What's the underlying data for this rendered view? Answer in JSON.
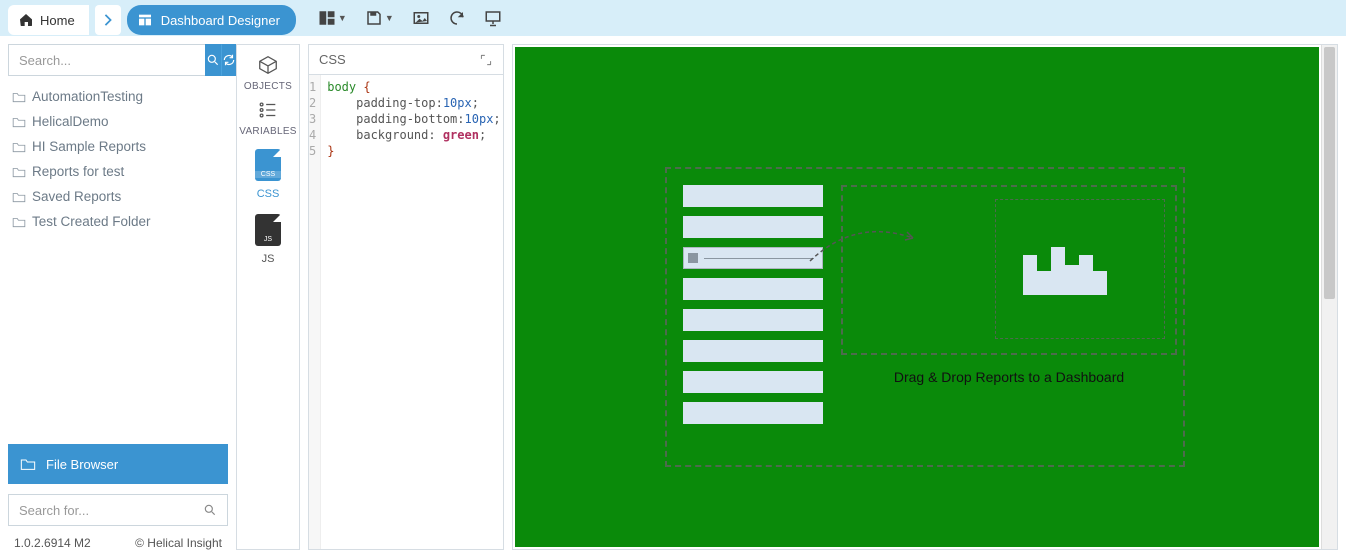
{
  "breadcrumb": {
    "home": "Home",
    "designer": "Dashboard Designer"
  },
  "search": {
    "placeholder": "Search..."
  },
  "folders": [
    "AutomationTesting",
    "HelicalDemo",
    "HI Sample Reports",
    "Reports for test",
    "Saved Reports",
    "Test Created Folder"
  ],
  "fileBrowser": {
    "label": "File Browser",
    "searchPlaceholder": "Search for..."
  },
  "footer": {
    "version": "1.0.2.6914 M2",
    "copyright": "© Helical Insight"
  },
  "tools": {
    "objects": "OBJECTS",
    "variables": "VARIABLES",
    "css": "CSS",
    "js": "JS"
  },
  "editor": {
    "title": "CSS",
    "lines": [
      "1",
      "2",
      "3",
      "4",
      "5"
    ],
    "code": {
      "l1_sel": "body",
      "l1_brace": " {",
      "l2_prop": "    padding-top:",
      "l2_val": "10px",
      "l3_prop": "    padding-bottom:",
      "l3_val": "10px",
      "l4_prop": "    background: ",
      "l4_kw": "green",
      "l5_brace": "}"
    }
  },
  "canvas": {
    "dropText": "Drag & Drop Reports to a Dashboard",
    "background": "#0a8a0a"
  },
  "icons": {
    "home": "home-icon",
    "chevron": "chevron-right-icon",
    "layout": "layout-icon",
    "save": "save-icon",
    "image": "image-icon",
    "refresh": "refresh-icon",
    "present": "presentation-icon",
    "search": "search-icon",
    "sync": "sync-icon",
    "folder": "folder-icon",
    "expand": "expand-icon"
  }
}
